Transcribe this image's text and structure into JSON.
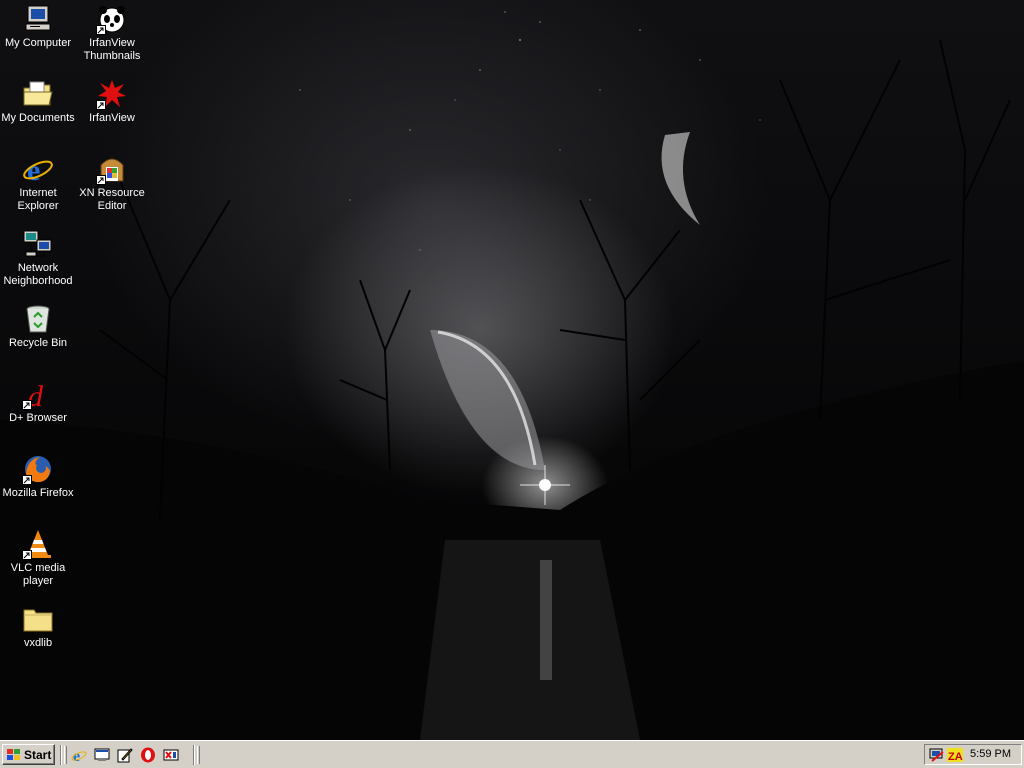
{
  "desktop": {
    "icons": [
      {
        "label": "My Computer"
      },
      {
        "label": "IrfanView Thumbnails"
      },
      {
        "label": "My Documents"
      },
      {
        "label": "IrfanView"
      },
      {
        "label": "Internet Explorer"
      },
      {
        "label": "XN Resource Editor"
      },
      {
        "label": "Network Neighborhood"
      },
      {
        "label": "Recycle Bin"
      },
      {
        "label": "D+ Browser"
      },
      {
        "label": "Mozilla Firefox"
      },
      {
        "label": "VLC media player"
      },
      {
        "label": "vxdlib"
      }
    ]
  },
  "taskbar": {
    "start_label": "Start",
    "quick_launch": [
      "internet-explorer-icon",
      "show-desktop-icon",
      "edit-icon",
      "opera-icon",
      "xn-icon"
    ],
    "tray": {
      "icons": [
        "network-monitor-icon",
        "zonealarm-icon"
      ],
      "clock": "5:59 PM"
    }
  },
  "colors": {
    "taskbar_bg": "#d4d0c8",
    "desktop_bg": "#0a0a0c"
  }
}
